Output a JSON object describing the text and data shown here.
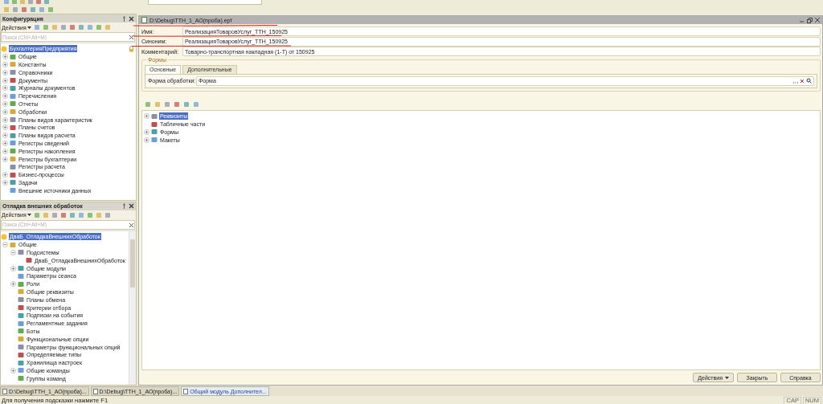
{
  "panels": [
    {
      "title": "Конфигурация",
      "actions_label": "Действия",
      "search": {
        "placeholder": "Поиск (Ctrl+Alt+M)"
      },
      "tree": [
        {
          "label": "БухгалтерияПредприятия",
          "selected": true,
          "locked": true,
          "children": [
            {
              "label": "Общие",
              "selected": false,
              "expandable": true,
              "expanded": false
            },
            {
              "label": "Константы",
              "selected": false,
              "expandable": true,
              "expanded": false
            },
            {
              "label": "Справочники",
              "selected": false,
              "expandable": true,
              "expanded": false
            },
            {
              "label": "Документы",
              "selected": false,
              "expandable": true,
              "expanded": false
            },
            {
              "label": "Журналы документов",
              "selected": false,
              "expandable": true,
              "expanded": false
            },
            {
              "label": "Перечисления",
              "selected": false,
              "expandable": true,
              "expanded": false
            },
            {
              "label": "Отчеты",
              "selected": false,
              "expandable": true,
              "expanded": false
            },
            {
              "label": "Обработки",
              "selected": false,
              "expandable": true,
              "expanded": false
            },
            {
              "label": "Планы видов характеристик",
              "selected": false,
              "expandable": true,
              "expanded": false
            },
            {
              "label": "Планы счетов",
              "selected": false,
              "expandable": true,
              "expanded": false
            },
            {
              "label": "Планы видов расчета",
              "selected": false,
              "expandable": true,
              "expanded": false
            },
            {
              "label": "Регистры сведений",
              "selected": false,
              "expandable": true,
              "expanded": false
            },
            {
              "label": "Регистры накопления",
              "selected": false,
              "expandable": true,
              "expanded": false
            },
            {
              "label": "Регистры бухгалтерии",
              "selected": false,
              "expandable": true,
              "expanded": false
            },
            {
              "label": "Регистры расчета",
              "selected": false,
              "expandable": false
            },
            {
              "label": "Бизнес-процессы",
              "selected": false,
              "expandable": true,
              "expanded": false
            },
            {
              "label": "Задачи",
              "selected": false,
              "expandable": true,
              "expanded": false
            },
            {
              "label": "Внешние источники данных",
              "selected": false,
              "expandable": false
            }
          ]
        }
      ]
    },
    {
      "title": "Отладка внешних обработок",
      "actions_label": "Действия",
      "search": {
        "placeholder": "Поиск (Ctrl+Alt+M)"
      },
      "scrollable": true,
      "tree": [
        {
          "label": "ДваБ_ОтладкаВнешнихОбработок",
          "selected": true,
          "children": [
            {
              "label": "Общие",
              "selected": false,
              "expandable": true,
              "expanded": true,
              "children": [
                {
                  "label": "Подсистемы",
                  "selected": false,
                  "expandable": true,
                  "expanded": true,
                  "children": [
                    {
                      "label": "ДваБ_ОтладкаВнешнихОбработок",
                      "selected": false,
                      "expandable": false
                    }
                  ]
                },
                {
                  "label": "Общие модули",
                  "selected": false,
                  "expandable": true,
                  "expanded": false
                },
                {
                  "label": "Параметры сеанса",
                  "selected": false,
                  "expandable": false
                },
                {
                  "label": "Роли",
                  "selected": false,
                  "expandable": true,
                  "expanded": false
                },
                {
                  "label": "Общие реквизиты",
                  "selected": false,
                  "expandable": false
                },
                {
                  "label": "Планы обмена",
                  "selected": false,
                  "expandable": false
                },
                {
                  "label": "Критерии отбора",
                  "selected": false,
                  "expandable": false
                },
                {
                  "label": "Подписки на события",
                  "selected": false,
                  "expandable": false
                },
                {
                  "label": "Регламентные задания",
                  "selected": false,
                  "expandable": false
                },
                {
                  "label": "Боты",
                  "selected": false,
                  "expandable": false
                },
                {
                  "label": "Функциональные опции",
                  "selected": false,
                  "expandable": false
                },
                {
                  "label": "Параметры функциональных опций",
                  "selected": false,
                  "expandable": false
                },
                {
                  "label": "Определяемые типы",
                  "selected": false,
                  "expandable": false
                },
                {
                  "label": "Хранилища настроек",
                  "selected": false,
                  "expandable": false
                },
                {
                  "label": "Общие команды",
                  "selected": false,
                  "expandable": true,
                  "expanded": false
                },
                {
                  "label": "Группы команд",
                  "selected": false,
                  "expandable": false
                }
              ]
            }
          ]
        }
      ]
    }
  ],
  "window": {
    "title": "D:\\Debug\\ТТН_1_АО(проба).epf",
    "fields": [
      {
        "label": "Имя:",
        "value": "РеализацияТоваровУслуг_ТТН_150925"
      },
      {
        "label": "Синоним:",
        "value": "РеализацияТоваровУслуг_ТТН_150925"
      },
      {
        "label": "Комментарий:",
        "value": "Товарно-транспортная накладная (1-Т) от 150925"
      }
    ],
    "forms_group": {
      "title": "Формы",
      "tabs": [
        {
          "label": "Основные",
          "selected": true
        },
        {
          "label": "Дополнительные",
          "selected": false
        }
      ],
      "fields": [
        {
          "label": "Форма обработки:",
          "value": "Форма"
        }
      ]
    },
    "tree": [
      {
        "label": "Реквизиты",
        "selected": true,
        "expandable": true,
        "expanded": false
      },
      {
        "label": "Табличные части",
        "selected": false,
        "expandable": false
      },
      {
        "label": "Формы",
        "selected": false,
        "expandable": true,
        "expanded": false
      },
      {
        "label": "Макеты",
        "selected": false,
        "expandable": true,
        "expanded": false
      }
    ],
    "buttons": [
      {
        "label": "Действия",
        "kind": "dropdown"
      },
      {
        "label": "Закрыть",
        "kind": "plain"
      },
      {
        "label": "Справка",
        "kind": "plain"
      }
    ]
  },
  "taskbar": [
    {
      "label": "D:\\Debug\\ТТН_1_АО(проба)...",
      "selected": false
    },
    {
      "label": "D:\\Debug\\ТТН_1_АО(проба)...",
      "selected": false
    },
    {
      "label": "Общий модуль Дополнител...",
      "selected": true
    }
  ],
  "status_bar": {
    "hint": "Для получения подсказки нажмите F1",
    "indicators": [
      "CAP",
      "NUM"
    ]
  }
}
